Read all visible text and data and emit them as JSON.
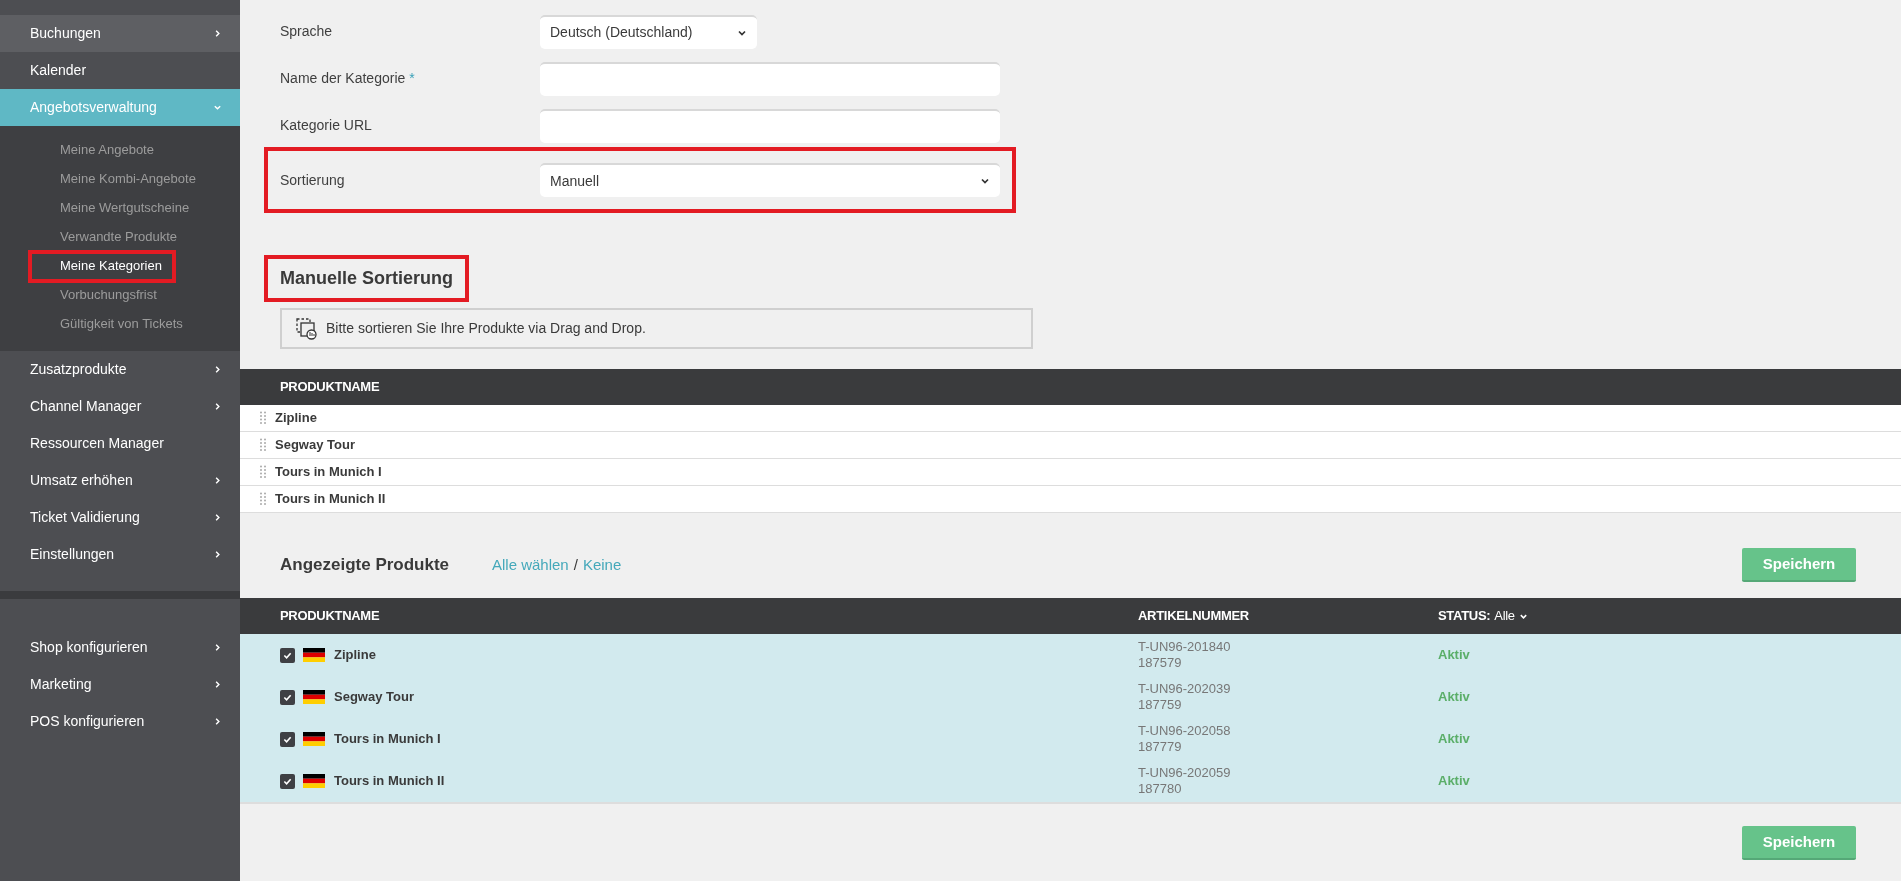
{
  "sidebar": {
    "groups": [
      {
        "items": [
          {
            "kind": "expandable",
            "label": "Buchungen",
            "hover": true,
            "active": false
          },
          {
            "kind": "plain",
            "label": "Kalender",
            "hover": false,
            "active": false
          },
          {
            "kind": "expanded",
            "label": "Angebotsverwaltung",
            "hover": false,
            "active": true,
            "children": [
              {
                "label": "Meine Angebote",
                "selected": false,
                "highlighted": false
              },
              {
                "label": "Meine Kombi-Angebote",
                "selected": false,
                "highlighted": false
              },
              {
                "label": "Meine Wertgutscheine",
                "selected": false,
                "highlighted": false
              },
              {
                "label": "Verwandte Produkte",
                "selected": false,
                "highlighted": false
              },
              {
                "label": "Meine Kategorien",
                "selected": true,
                "highlighted": true
              },
              {
                "label": "Vorbuchungsfrist",
                "selected": false,
                "highlighted": false
              },
              {
                "label": "Gültigkeit von Tickets",
                "selected": false,
                "highlighted": false
              }
            ]
          },
          {
            "kind": "expandable",
            "label": "Zusatzprodukte",
            "hover": false,
            "active": false
          },
          {
            "kind": "expandable",
            "label": "Channel Manager",
            "hover": false,
            "active": false
          },
          {
            "kind": "plain",
            "label": "Ressourcen Manager",
            "hover": false,
            "active": false
          },
          {
            "kind": "expandable",
            "label": "Umsatz erhöhen",
            "hover": false,
            "active": false
          },
          {
            "kind": "expandable",
            "label": "Ticket Validierung",
            "hover": false,
            "active": false
          },
          {
            "kind": "expandable",
            "label": "Einstellungen",
            "hover": false,
            "active": false
          }
        ]
      },
      {
        "items": [
          {
            "kind": "expandable",
            "label": "Shop konfigurieren",
            "hover": false,
            "active": false
          },
          {
            "kind": "expandable",
            "label": "Marketing",
            "hover": false,
            "active": false
          },
          {
            "kind": "expandable",
            "label": "POS konfigurieren",
            "hover": false,
            "active": false
          }
        ]
      }
    ]
  },
  "form": {
    "fields": [
      {
        "kind": "compact-select",
        "label": "Sprache",
        "value": "Deutsch (Deutschland)",
        "highlighted": false
      },
      {
        "kind": "text",
        "label": "Name der Kategorie",
        "required_mark": "*",
        "highlighted": false
      },
      {
        "kind": "text",
        "label": "Kategorie URL",
        "highlighted": false
      },
      {
        "kind": "select",
        "label": "Sortierung",
        "value": "Manuell",
        "highlighted": true
      }
    ]
  },
  "manual_sorting": {
    "title": "Manuelle Sortierung",
    "highlighted": true,
    "hint": "Bitte sortieren Sie Ihre Produkte via Drag and Drop.",
    "table": {
      "columns": [
        "PRODUKTNAME"
      ],
      "rows": [
        "Zipline",
        "Segway Tour",
        "Tours in Munich I",
        "Tours in Munich II"
      ]
    }
  },
  "displayed_products": {
    "title": "Angezeigte Produkte",
    "select_all": "Alle wählen",
    "separator": "/",
    "select_none": "Keine",
    "save_button": "Speichern",
    "table": {
      "columns": [
        "PRODUKTNAME",
        "ARTIKELNUMMER"
      ],
      "status_filter": {
        "label": "STATUS:",
        "value": "Alle"
      },
      "rows": [
        {
          "checked": true,
          "name": "Zipline",
          "sku": "T-UN96-201840",
          "id": "187579",
          "status": "Aktiv"
        },
        {
          "checked": true,
          "name": "Segway Tour",
          "sku": "T-UN96-202039",
          "id": "187759",
          "status": "Aktiv"
        },
        {
          "checked": true,
          "name": "Tours in Munich I",
          "sku": "T-UN96-202058",
          "id": "187779",
          "status": "Aktiv"
        },
        {
          "checked": true,
          "name": "Tours in Munich II",
          "sku": "T-UN96-202059",
          "id": "187780",
          "status": "Aktiv"
        }
      ]
    },
    "bottom_save_button": "Speichern"
  }
}
